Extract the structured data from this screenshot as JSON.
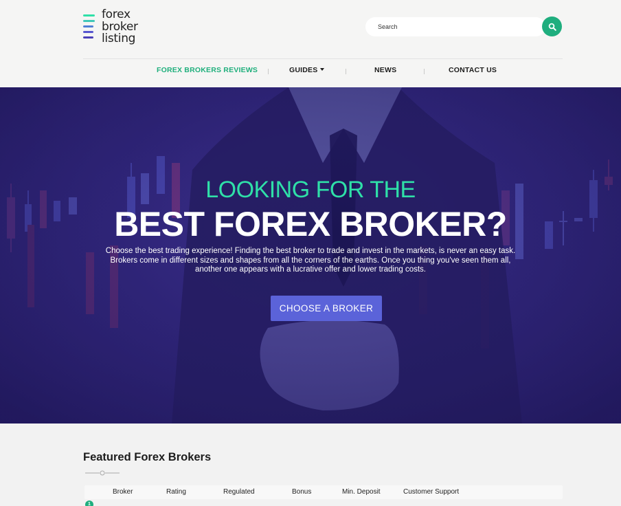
{
  "logo": {
    "lines": [
      "forex",
      "broker",
      "listing"
    ],
    "bar_colors": [
      "#2fe0a8",
      "#3fc8b8",
      "#4f7fd6",
      "#5656cf",
      "#4a3fb8"
    ]
  },
  "search": {
    "placeholder": "Search",
    "button_icon": "search-icon"
  },
  "nav": {
    "items": [
      "FOREX BROKERS REVIEWS",
      "GUIDES",
      "NEWS",
      "CONTACT US"
    ],
    "active_color": "#1faf7c"
  },
  "hero": {
    "title_line1": "LOOKING FOR THE",
    "title_line2": "BEST FOREX BROKER?",
    "text": "Choose the best trading experience! Finding the best  broker to trade and invest in the markets, is never an easy task. Brokers come in different sizes and shapes from all the corners of the earths. Once you thing you've seen them all, another one appears with a lucrative offer and lower trading costs.",
    "cta_label": "CHOOSE A BROKER",
    "accent_color": "#2fe0a8",
    "cta_color": "#5b63d9"
  },
  "featured": {
    "title": "Featured Forex Brokers",
    "columns": [
      "Broker",
      "Rating",
      "Regulated",
      "Bonus",
      "Min. Deposit",
      "Customer Support"
    ],
    "first_row_number": "1"
  }
}
